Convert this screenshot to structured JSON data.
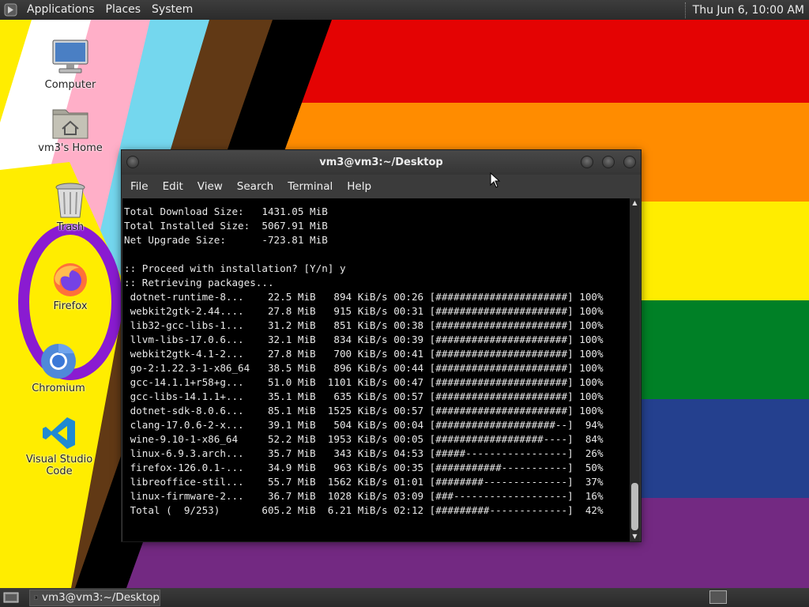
{
  "top_panel": {
    "menu_applications": "Applications",
    "menu_places": "Places",
    "menu_system": "System",
    "clock": "Thu Jun  6, 10:00 AM"
  },
  "desktop_icons": [
    {
      "label": "Computer",
      "icon": "computer-icon"
    },
    {
      "label": "vm3's Home",
      "icon": "home-folder-icon"
    },
    {
      "label": "Trash",
      "icon": "trash-icon"
    },
    {
      "label": "Firefox",
      "icon": "firefox-icon"
    },
    {
      "label": "Chromium",
      "icon": "chromium-icon"
    },
    {
      "label": "Visual Studio Code",
      "icon": "vscode-icon"
    }
  ],
  "terminal": {
    "title": "vm3@vm3:~/Desktop",
    "menus": [
      "File",
      "Edit",
      "View",
      "Search",
      "Terminal",
      "Help"
    ],
    "lines": [
      "Total Download Size:   1431.05 MiB",
      "Total Installed Size:  5067.91 MiB",
      "Net Upgrade Size:      -723.81 MiB",
      "",
      ":: Proceed with installation? [Y/n] y",
      ":: Retrieving packages...",
      " dotnet-runtime-8...    22.5 MiB   894 KiB/s 00:26 [######################] 100%",
      " webkit2gtk-2.44....    27.8 MiB   915 KiB/s 00:31 [######################] 100%",
      " lib32-gcc-libs-1...    31.2 MiB   851 KiB/s 00:38 [######################] 100%",
      " llvm-libs-17.0.6...    32.1 MiB   834 KiB/s 00:39 [######################] 100%",
      " webkit2gtk-4.1-2...    27.8 MiB   700 KiB/s 00:41 [######################] 100%",
      " go-2:1.22.3-1-x86_64   38.5 MiB   896 KiB/s 00:44 [######################] 100%",
      " gcc-14.1.1+r58+g...    51.0 MiB  1101 KiB/s 00:47 [######################] 100%",
      " gcc-libs-14.1.1+...    35.1 MiB   635 KiB/s 00:57 [######################] 100%",
      " dotnet-sdk-8.0.6...    85.1 MiB  1525 KiB/s 00:57 [######################] 100%",
      " clang-17.0.6-2-x...    39.1 MiB   504 KiB/s 00:04 [####################--]  94%",
      " wine-9.10-1-x86_64     52.2 MiB  1953 KiB/s 00:05 [##################----]  84%",
      " linux-6.9.3.arch...    35.7 MiB   343 KiB/s 04:53 [#####-----------------]  26%",
      " firefox-126.0.1-...    34.9 MiB   963 KiB/s 00:35 [###########-----------]  50%",
      " libreoffice-stil...    55.7 MiB  1562 KiB/s 01:01 [########--------------]  37%",
      " linux-firmware-2...    36.7 MiB  1028 KiB/s 03:09 [###-------------------]  16%",
      " Total (  9/253)       605.2 MiB  6.21 MiB/s 02:12 [#########-------------]  42%"
    ]
  },
  "taskbar": {
    "task_label": "vm3@vm3:~/Desktop"
  },
  "colors": {
    "panel": "#2f2f2f",
    "terminal_bg": "#000000",
    "terminal_fg": "#e8e8e8",
    "window_chrome": "#3b3b3b"
  }
}
